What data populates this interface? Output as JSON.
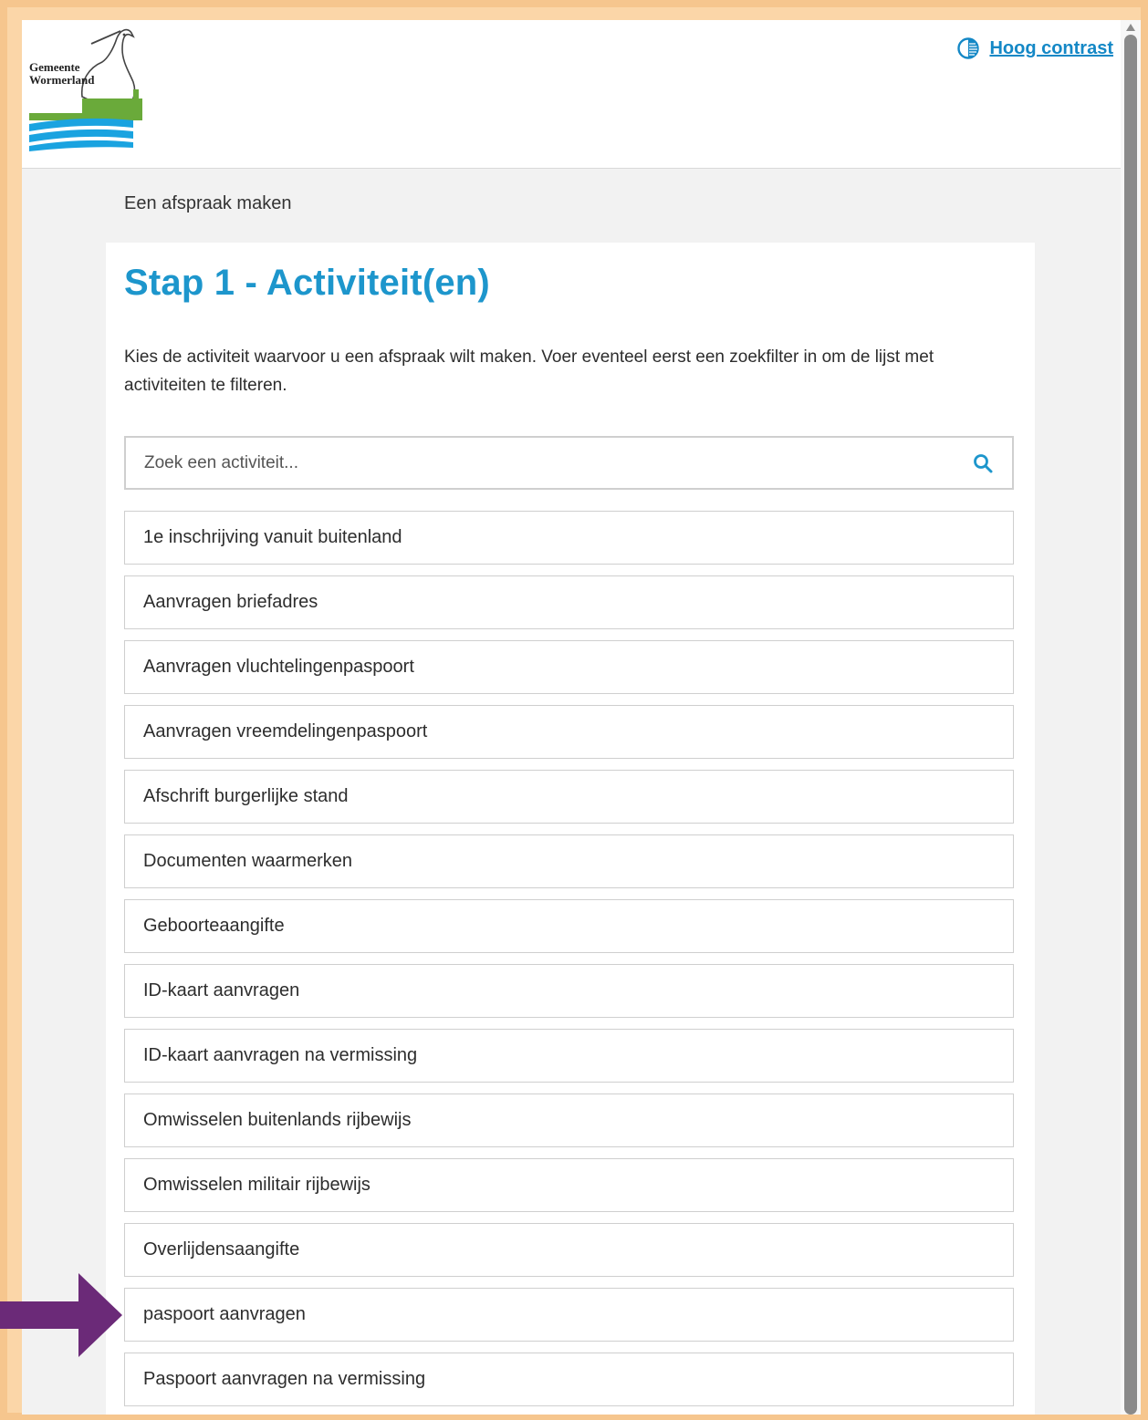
{
  "header": {
    "logo": {
      "line1": "Gemeente",
      "line2": "Wormerland"
    },
    "contrast_label": "Hoog contrast"
  },
  "breadcrumb": "Een afspraak maken",
  "main": {
    "title": "Stap 1 - Activiteit(en)",
    "intro": "Kies de activiteit waarvoor u een afspraak wilt maken. Voer eventeel eerst een zoekfilter in om de lijst met activiteiten te filteren.",
    "search": {
      "placeholder": "Zoek een activiteit...",
      "value": ""
    },
    "activities": [
      "1e inschrijving vanuit buitenland",
      "Aanvragen briefadres",
      "Aanvragen vluchtelingenpaspoort",
      "Aanvragen vreemdelingenpaspoort",
      "Afschrift burgerlijke stand",
      "Documenten waarmerken",
      "Geboorteaangifte",
      "ID-kaart aanvragen",
      "ID-kaart aanvragen na vermissing",
      "Omwisselen buitenlands rijbewijs",
      "Omwisselen militair rijbewijs",
      "Overlijdensaangifte",
      "paspoort aanvragen",
      "Paspoort aanvragen na vermissing"
    ]
  },
  "colors": {
    "accent": "#1d96cc",
    "link": "#1488c6",
    "annotation_arrow": "#6b2a78",
    "frame": "#f6c68e"
  },
  "annotation": {
    "arrow_target_item": "paspoort aanvragen"
  }
}
